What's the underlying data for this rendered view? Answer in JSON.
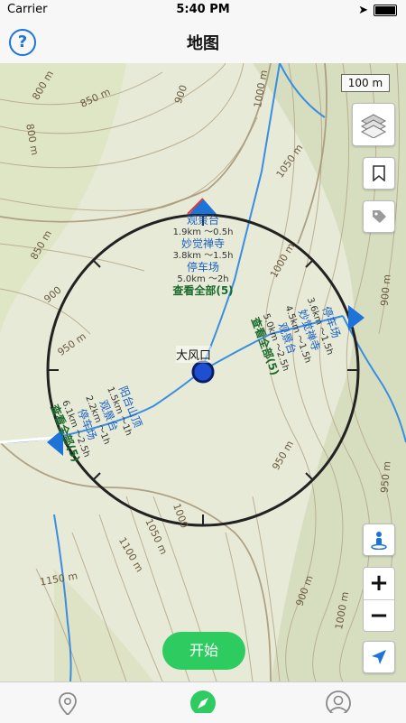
{
  "status": {
    "carrier": "Carrier",
    "time": "5:40 PM"
  },
  "nav": {
    "title": "地图"
  },
  "map": {
    "scale": "100 m",
    "center_label": "大风口",
    "contours": [
      "800 m",
      "850 m",
      "800 m",
      "900",
      "850 m",
      "900",
      "950 m",
      "1000 m",
      "1050 m",
      "1000 m",
      "950 m",
      "900 m",
      "950 m",
      "1000",
      "1050 m",
      "1100 m",
      "1150 m",
      "900 m",
      "1000 m"
    ],
    "north_group": {
      "l1": "观景台",
      "l2": "1.9km ～0.5h",
      "l3": "妙觉禅寺",
      "l4": "3.8km ～1.5h",
      "l5": "停车场",
      "l6": "5.0km ～2h",
      "more": "查看全部(5)"
    },
    "east_group": {
      "l1": "停车场",
      "l2": "3.6km ～1.5h",
      "l3": "妙觉禅寺",
      "l4": "4.5km ～1.5h",
      "l5": "观景台",
      "l6": "5.0km ～2.5h",
      "more": "查看全部(5)"
    },
    "west_group": {
      "l1": "阳台山顶",
      "l2": "1.5km ～1h",
      "l3": "观景台",
      "l4": "2.2km ～1h",
      "l5": "停车场",
      "l6": "6.1km ～2.5h",
      "more": "查看全部(5)"
    }
  },
  "start_label": "开始",
  "colors": {
    "accent": "#1e73d8",
    "start": "#2ecc60",
    "dest_blue": "#1a5fc4",
    "dest_green": "#1c6a2e"
  }
}
